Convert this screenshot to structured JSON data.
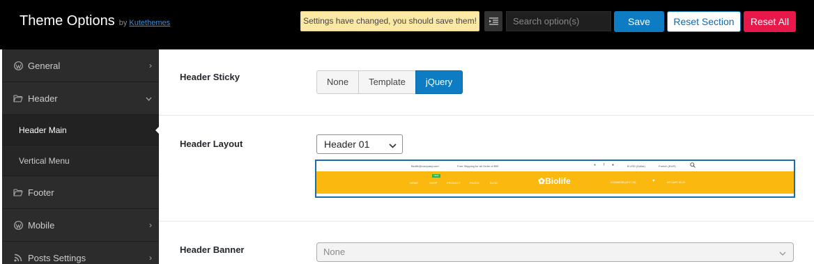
{
  "app": {
    "title": "Theme Options",
    "by": "by",
    "author_link": "Kutethemes"
  },
  "toolbar": {
    "notice": "Settings have changed, you should save them!",
    "search_placeholder": "Search option(s)",
    "save_label": "Save",
    "reset_section_label": "Reset Section",
    "reset_all_label": "Reset All"
  },
  "sidebar": {
    "items": [
      {
        "label": "General",
        "icon": "wordpress-icon",
        "chevron": "›"
      },
      {
        "label": "Header",
        "icon": "folder-open-icon",
        "chevron": "⌄"
      },
      {
        "label": "Header Main"
      },
      {
        "label": "Vertical Menu"
      },
      {
        "label": "Footer",
        "icon": "folder-open-icon"
      },
      {
        "label": "Mobile",
        "icon": "wordpress-icon",
        "chevron": "›"
      },
      {
        "label": "Posts Settings",
        "icon": "rss-icon",
        "chevron": "›"
      }
    ]
  },
  "fields": {
    "header_sticky": {
      "label": "Header Sticky",
      "options": [
        "None",
        "Template",
        "jQuery"
      ],
      "selected": "jQuery"
    },
    "header_layout": {
      "label": "Header Layout",
      "value": "Header 01",
      "preview": {
        "top_email": "Biolife@company.com",
        "top_shipping": "Free Shipping for all Order of $99",
        "top_currency": "$ USD (Dollar)",
        "top_lang": "French (EUR)",
        "nav": [
          "HOME",
          "SHOP",
          "PRODUCT",
          "PAGES",
          "BLOG"
        ],
        "badge": "NEW",
        "logo": "Biolife",
        "phone": "0123456789 (09:17:19)",
        "cart": "MY CART: $0.00",
        "accent_color": "#fbb80f"
      }
    },
    "header_banner": {
      "label": "Header Banner",
      "value": "None"
    }
  },
  "colors": {
    "topbar": "#000000",
    "sidebar": "#2c2c2c",
    "primary": "#0d7cc3",
    "danger": "#e8184a",
    "notice_bg": "#fbe8a5"
  }
}
